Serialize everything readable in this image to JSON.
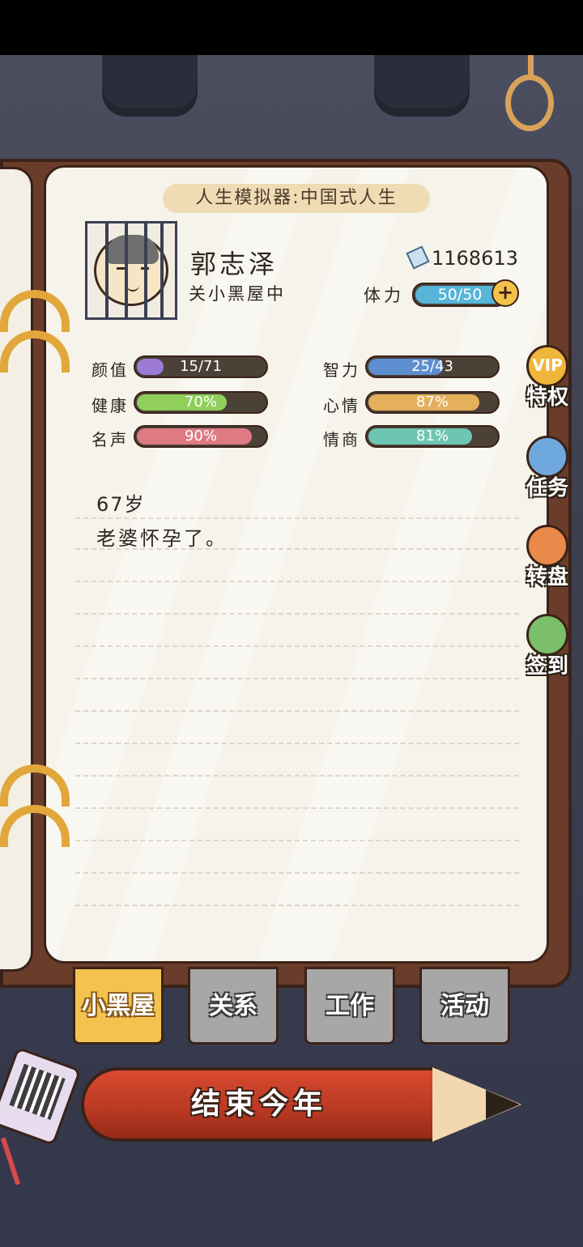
{
  "header": {
    "title": "人生模拟器:中国式人生"
  },
  "player": {
    "name": "郭志泽",
    "status": "关小黑屋中",
    "currency": "1168613",
    "stamina_label": "体力",
    "stamina": "50/50",
    "stamina_fraction": 1.0
  },
  "stats": [
    {
      "label": "颜值",
      "value": "15/71",
      "fraction": 0.21,
      "color": "#9c7ad6"
    },
    {
      "label": "智力",
      "value": "25/43",
      "fraction": 0.58,
      "color": "#5c8ed0"
    },
    {
      "label": "健康",
      "value": "70%",
      "fraction": 0.7,
      "color": "#8fcf5a"
    },
    {
      "label": "心情",
      "value": "87%",
      "fraction": 0.87,
      "color": "#e5b05c"
    },
    {
      "label": "名声",
      "value": "90%",
      "fraction": 0.9,
      "color": "#e07a84"
    },
    {
      "label": "情商",
      "value": "81%",
      "fraction": 0.81,
      "color": "#6ec6b2"
    }
  ],
  "log": {
    "age": "67岁",
    "event": "老婆怀孕了。"
  },
  "side_menu": [
    {
      "label": "特权",
      "icon": "vip-badge-icon",
      "badge": "VIP",
      "color": "#f0b63a"
    },
    {
      "label": "任务",
      "icon": "clipboard-icon",
      "color": "#6fa8dc"
    },
    {
      "label": "转盘",
      "icon": "wheel-icon",
      "color": "#e98a4a"
    },
    {
      "label": "签到",
      "icon": "pencil-book-icon",
      "color": "#7cbf6a"
    }
  ],
  "tabs": [
    {
      "label": "小黑屋",
      "active": true
    },
    {
      "label": "关系",
      "active": false
    },
    {
      "label": "工作",
      "active": false
    },
    {
      "label": "活动",
      "active": false
    }
  ],
  "end_year_button": "结束今年"
}
